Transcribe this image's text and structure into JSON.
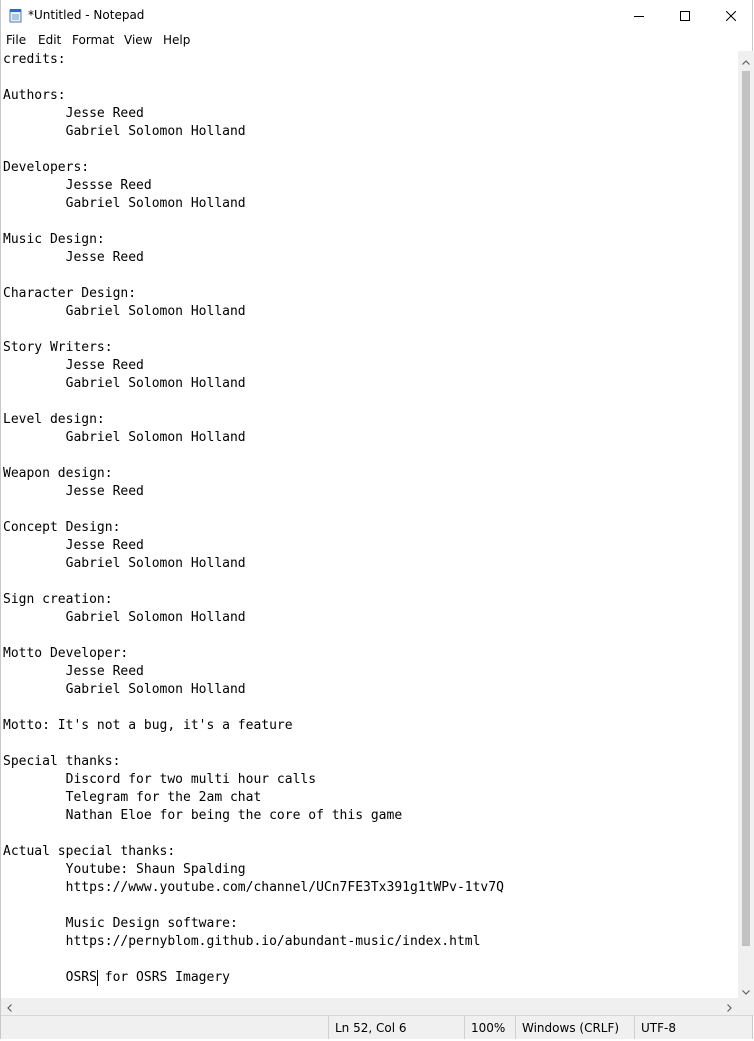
{
  "window": {
    "title": "*Untitled - Notepad"
  },
  "menu": [
    "File",
    "Edit",
    "Format",
    "View",
    "Help"
  ],
  "editor": {
    "lines": [
      "credits:",
      "",
      "Authors:",
      "        Jesse Reed",
      "        Gabriel Solomon Holland",
      "",
      "Developers:",
      "        Jessse Reed",
      "        Gabriel Solomon Holland",
      "",
      "Music Design:",
      "        Jesse Reed",
      "",
      "Character Design:",
      "        Gabriel Solomon Holland",
      "",
      "Story Writers:",
      "        Jesse Reed",
      "        Gabriel Solomon Holland",
      "",
      "Level design:",
      "        Gabriel Solomon Holland",
      "",
      "Weapon design:",
      "        Jesse Reed",
      "",
      "Concept Design:",
      "        Jesse Reed",
      "        Gabriel Solomon Holland",
      "",
      "Sign creation:",
      "        Gabriel Solomon Holland",
      "",
      "Motto Developer:",
      "        Jesse Reed",
      "        Gabriel Solomon Holland",
      "",
      "Motto: It's not a bug, it's a feature",
      "",
      "Special thanks:",
      "        Discord for two multi hour calls",
      "        Telegram for the 2am chat",
      "        Nathan Eloe for being the core of this game",
      "",
      "Actual special thanks:",
      "        Youtube: Shaun Spalding",
      "        https://www.youtube.com/channel/UCn7FE3Tx391g1tWPv-1tv7Q",
      "",
      "        Music Design software:",
      "        https://pernyblom.github.io/abundant-music/index.html",
      "",
      "        OSRS for OSRS Imagery"
    ]
  },
  "status": {
    "position": "Ln 52, Col 6",
    "zoom": "100%",
    "line_ending": "Windows (CRLF)",
    "encoding": "UTF-8"
  },
  "icons": {
    "app": "notepad-icon",
    "minimize": "minimize-icon",
    "maximize": "maximize-icon",
    "close": "close-icon"
  }
}
